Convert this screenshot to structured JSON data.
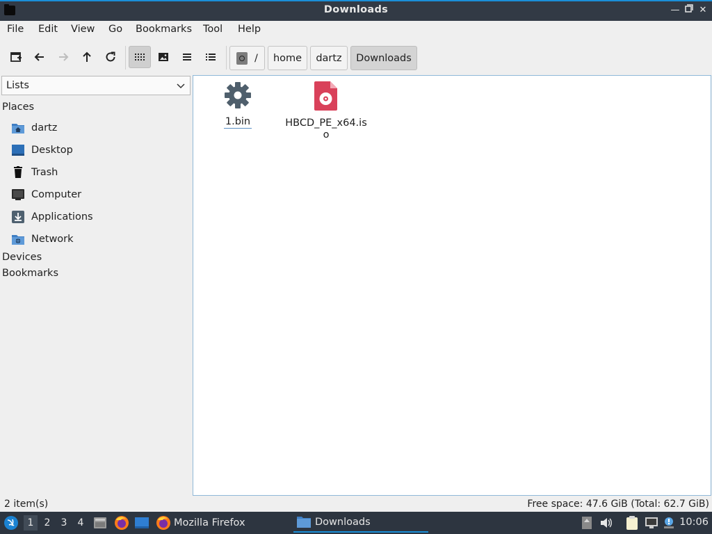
{
  "window": {
    "title": "Downloads"
  },
  "menubar": {
    "items": [
      "File",
      "Edit",
      "View",
      "Go",
      "Bookmarks",
      "Tool",
      "Help"
    ]
  },
  "breadcrumb": [
    {
      "label": "/"
    },
    {
      "label": "home"
    },
    {
      "label": "dartz"
    },
    {
      "label": "Downloads"
    }
  ],
  "sidepane": {
    "selector": "Lists",
    "places_header": "Places",
    "places": [
      {
        "label": "dartz",
        "icon": "home-folder-icon"
      },
      {
        "label": "Desktop",
        "icon": "desktop-icon"
      },
      {
        "label": "Trash",
        "icon": "trash-icon"
      },
      {
        "label": "Computer",
        "icon": "computer-icon"
      },
      {
        "label": "Applications",
        "icon": "applications-icon"
      },
      {
        "label": "Network",
        "icon": "network-icon"
      }
    ],
    "devices_header": "Devices",
    "bookmarks_header": "Bookmarks"
  },
  "files": [
    {
      "name": "1.bin",
      "icon": "binary-gear-icon"
    },
    {
      "name": "HBCD_PE_x64.iso",
      "icon": "disc-image-icon"
    }
  ],
  "statusbar": {
    "count": "2 item(s)",
    "free_space": "Free space: 47.6 GiB (Total: 62.7 GiB)"
  },
  "taskbar": {
    "workspaces": [
      "1",
      "2",
      "3",
      "4"
    ],
    "tasks": [
      {
        "label": "Mozilla Firefox",
        "icon": "firefox-icon"
      },
      {
        "label": "Downloads",
        "icon": "folder-icon"
      }
    ],
    "clock": "10:06"
  },
  "colors": {
    "accent": "#1a8fd8",
    "titlebar": "#323a45",
    "taskbar": "#2d3540",
    "iso_red": "#d9415a",
    "gear": "#4f5f6c"
  }
}
